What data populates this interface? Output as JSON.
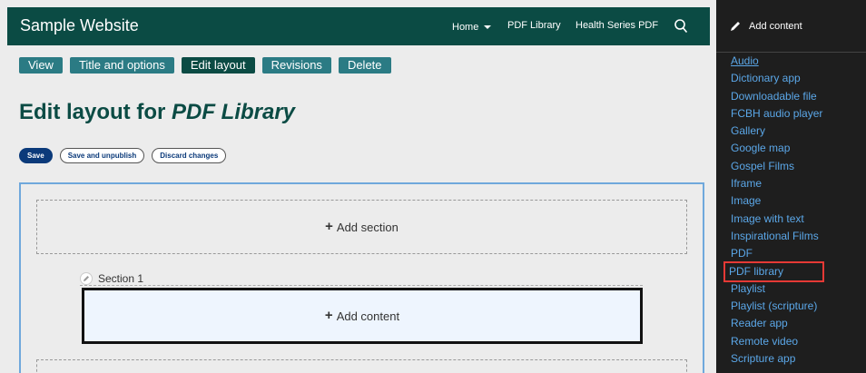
{
  "header": {
    "site_name": "Sample Website",
    "nav": {
      "home": "Home",
      "pdf_library": "PDF Library",
      "health_series": "Health Series PDF"
    }
  },
  "tabs": [
    "View",
    "Title and options",
    "Edit layout",
    "Revisions",
    "Delete"
  ],
  "page": {
    "title_prefix": "Edit layout for ",
    "title_name": "PDF Library"
  },
  "actions": {
    "save": "Save",
    "save_unpublish": "Save and unpublish",
    "discard": "Discard changes"
  },
  "builder": {
    "add_section": "Add section",
    "section_label": "Section 1",
    "add_content": "Add content"
  },
  "sidebar": {
    "title": "Add content",
    "items": [
      "Audio",
      "Dictionary app",
      "Downloadable file",
      "FCBH audio player",
      "Gallery",
      "Google map",
      "Gospel Films",
      "Iframe",
      "Image",
      "Image with text",
      "Inspirational Films",
      "PDF",
      "PDF library",
      "Playlist",
      "Playlist (scripture)",
      "Reader app",
      "Remote video",
      "Scripture app"
    ],
    "highlight_item": "PDF library"
  },
  "colors": {
    "header_bg": "#0b4b44",
    "tab_bg": "#2b7b84",
    "link_blue": "#5ba7e8",
    "highlight_border": "#e53935"
  }
}
